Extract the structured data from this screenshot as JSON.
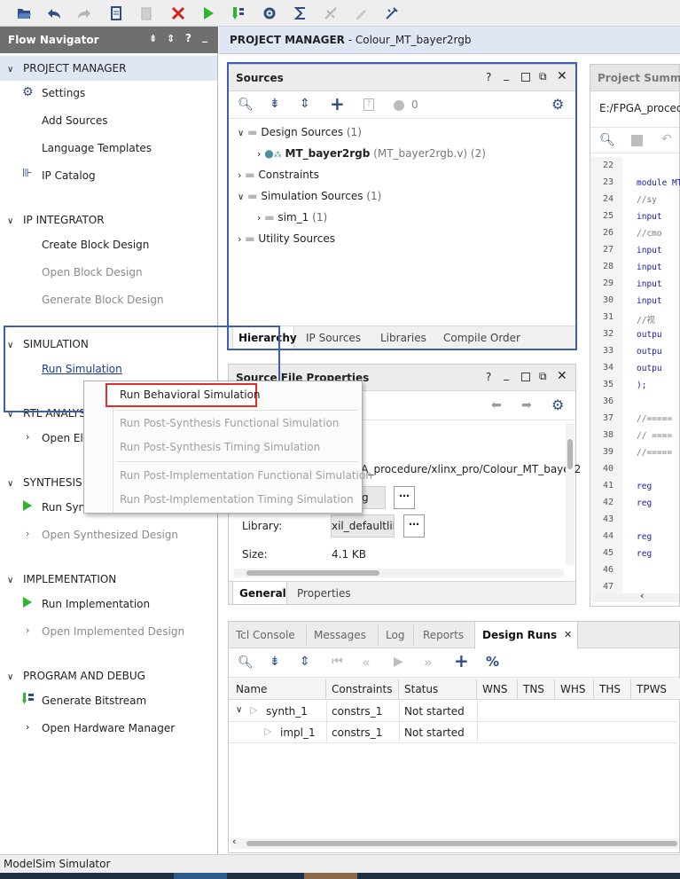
{
  "toolbar": {
    "icons": [
      "open-project-icon",
      "undo-icon",
      "redo-icon",
      "copy-icon",
      "paste-icon",
      "delete-icon",
      "run-icon",
      "download-icon",
      "settings-icon",
      "sum-icon",
      "auto-connect-icon",
      "pen-icon",
      "tools-icon"
    ]
  },
  "nav": {
    "title": "Flow Navigator",
    "sections": {
      "project_manager": "PROJECT MANAGER",
      "ip_integrator": "IP INTEGRATOR",
      "simulation": "SIMULATION",
      "rtl": "RTL ANALYS",
      "synthesis": "SYNTHESIS",
      "implementation": "IMPLEMENTATION",
      "program": "PROGRAM AND DEBUG"
    },
    "items": {
      "settings": "Settings",
      "add_sources": "Add Sources",
      "language_templates": "Language Templates",
      "ip_catalog": "IP Catalog",
      "create_block": "Create Block Design",
      "open_block": "Open Block Design",
      "generate_block": "Generate Block Design",
      "run_sim": "Run Simulation",
      "open_ela": "Open Ela",
      "run_synth": "Run Synt",
      "open_synth": "Open Synthesized Design",
      "run_impl": "Run Implementation",
      "open_impl": "Open Implemented Design",
      "gen_bit": "Generate Bitstream",
      "open_hw": "Open Hardware Manager"
    }
  },
  "header": {
    "prefix": "PROJECT MANAGER",
    "project": " - Colour_MT_bayer2rgb"
  },
  "sources": {
    "title": "Sources",
    "count": "0",
    "tree": {
      "design_sources": "Design Sources",
      "design_count": "(1)",
      "top_module": "MT_bayer2rgb",
      "top_file": "(MT_bayer2rgb.v) (2)",
      "constraints": "Constraints",
      "sim_sources": "Simulation Sources",
      "sim_count": "(1)",
      "sim1": "sim_1",
      "sim1_count": "(1)",
      "utility": "Utility Sources"
    },
    "tabs": [
      "Hierarchy",
      "IP Sources",
      "Libraries",
      "Compile Order"
    ]
  },
  "props": {
    "title": "Source File Properties",
    "path": "GA_procedure/xlinx_pro/Colour_MT_bayer2",
    "type_value": "g",
    "library_label": "Library:",
    "library_value": "xil_defaultlib",
    "size_label": "Size:",
    "size_value": "4.1 KB",
    "tabs": [
      "General",
      "Properties"
    ]
  },
  "summary": {
    "title": "Project Summar",
    "path": "E:/FPGA_proced",
    "lines": [
      {
        "n": "22",
        "t": ""
      },
      {
        "n": "23",
        "t": "module MT"
      },
      {
        "n": "24",
        "t": "  //sy"
      },
      {
        "n": "25",
        "t": "  input"
      },
      {
        "n": "26",
        "t": "  //cmo"
      },
      {
        "n": "27",
        "t": "  input"
      },
      {
        "n": "28",
        "t": "  input"
      },
      {
        "n": "29",
        "t": "  input"
      },
      {
        "n": "30",
        "t": "  input"
      },
      {
        "n": "31",
        "t": "  //视"
      },
      {
        "n": "32",
        "t": "  outpu"
      },
      {
        "n": "33",
        "t": "  outpu"
      },
      {
        "n": "34",
        "t": "  outpu"
      },
      {
        "n": "35",
        "t": "  );"
      },
      {
        "n": "36",
        "t": ""
      },
      {
        "n": "37",
        "t": "//====="
      },
      {
        "n": "38",
        "t": "// ===="
      },
      {
        "n": "39",
        "t": "//====="
      },
      {
        "n": "40",
        "t": ""
      },
      {
        "n": "41",
        "t": "reg"
      },
      {
        "n": "42",
        "t": "reg"
      },
      {
        "n": "43",
        "t": ""
      },
      {
        "n": "44",
        "t": "reg"
      },
      {
        "n": "45",
        "t": "reg"
      },
      {
        "n": "46",
        "t": ""
      },
      {
        "n": "47",
        "t": ""
      }
    ]
  },
  "bottom": {
    "tabs": [
      "Tcl Console",
      "Messages",
      "Log",
      "Reports",
      "Design Runs"
    ],
    "columns": [
      "Name",
      "Constraints",
      "Status",
      "WNS",
      "TNS",
      "WHS",
      "THS",
      "TPWS"
    ],
    "rows": [
      {
        "name": "synth_1",
        "constraints": "constrs_1",
        "status": "Not started"
      },
      {
        "name": "impl_1",
        "constraints": "constrs_1",
        "status": "Not started"
      }
    ]
  },
  "context_menu": {
    "items": [
      "Run Behavioral Simulation",
      "Run Post-Synthesis Functional Simulation",
      "Run Post-Synthesis Timing Simulation",
      "Run Post-Implementation Functional Simulation",
      "Run Post-Implementation Timing Simulation"
    ]
  },
  "status_bar": {
    "text": "ModelSim Simulator"
  },
  "colors": {
    "accent": "#2e64b5",
    "highlight": "#dfe7f5",
    "run_green": "#2db52d",
    "delete_red": "#d62020",
    "annotation_red": "#e0302a",
    "annotation_blue": "#3a5fb8"
  }
}
